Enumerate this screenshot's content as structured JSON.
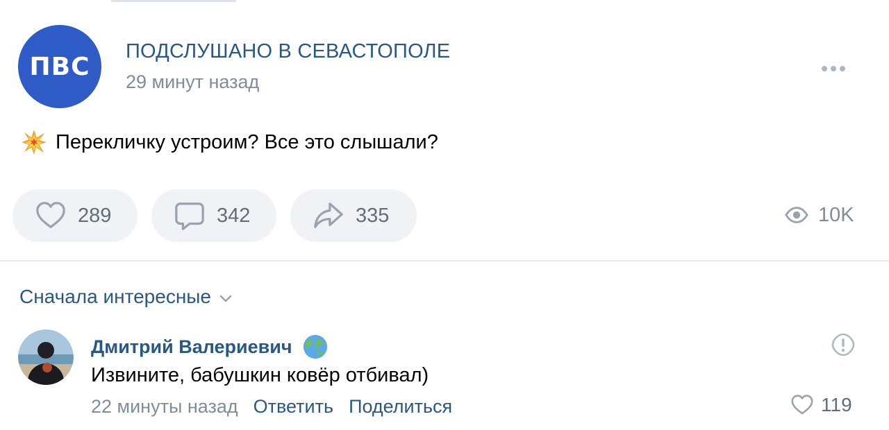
{
  "post": {
    "group_name": "ПОДСЛУШАНО В СЕВАСТОПОЛЕ",
    "group_avatar_text": "ПВС",
    "time": "29 минут назад",
    "text": "Перекличку устроим? Все это слышали?",
    "likes": "289",
    "comments": "342",
    "shares": "335",
    "views": "10K"
  },
  "comments_section": {
    "sort_label": "Сначала интересные"
  },
  "comment": {
    "author": "Дмитрий Валериевич",
    "text": "Извините, бабушкин ковёр отбивал)",
    "time": "22 минуты назад",
    "reply_label": "Ответить",
    "share_label": "Поделиться",
    "likes": "119"
  },
  "colors": {
    "link": "#2a5885",
    "secondary": "#818c99",
    "button_bg": "#f0f2f5",
    "avatar_bg": "#2f5bc7"
  }
}
